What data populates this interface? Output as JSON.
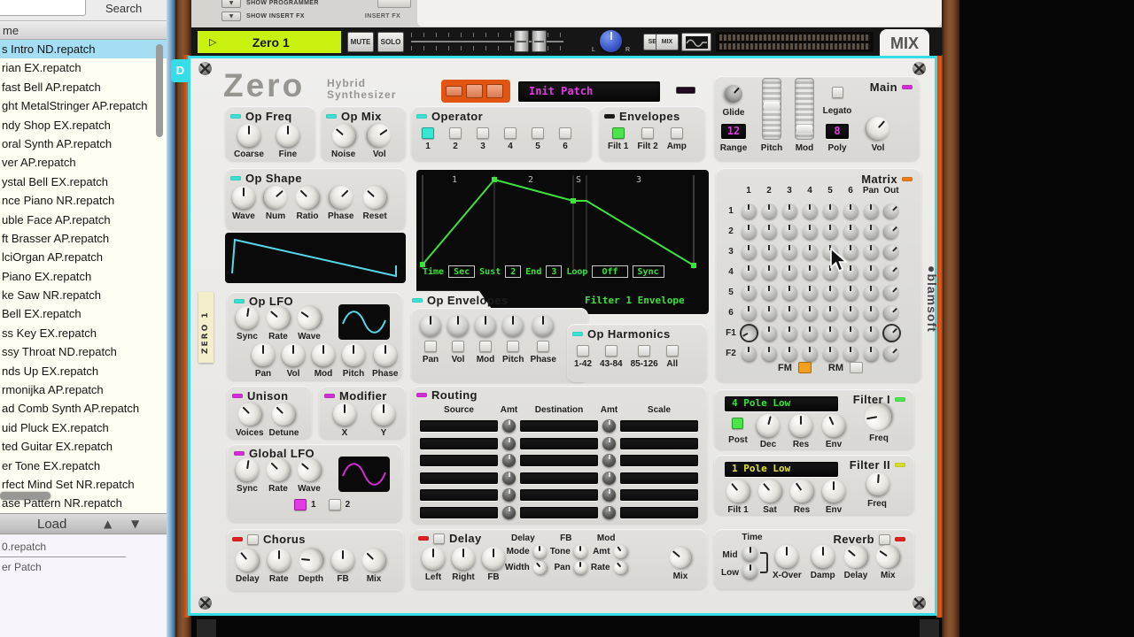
{
  "colors": {
    "selection_border": "#35dde8",
    "channel_lime": "#c9f211",
    "cyan_led": "#3ae0d4",
    "magenta_led": "#d22fd2",
    "orange_led": "#e87c1a",
    "green_led": "#4ce44c",
    "yellow_led": "#d8dc28",
    "red_led": "#e02020",
    "display_green": "#3de23d",
    "display_magenta": "#e23ae2",
    "display_yellow": "#e2e23d"
  },
  "sidebar": {
    "search_button": "Search",
    "column_header": "me",
    "files": [
      {
        "label": "s Intro ND.repatch",
        "on": true
      },
      {
        "label": "rian EX.repatch"
      },
      {
        "label": "fast Bell AP.repatch"
      },
      {
        "label": "ght MetalStringer AP.repatch"
      },
      {
        "label": "ndy Shop EX.repatch"
      },
      {
        "label": "oral Synth AP.repatch"
      },
      {
        "label": "ver AP.repatch"
      },
      {
        "label": "ystal Bell EX.repatch"
      },
      {
        "label": "nce Piano NR.repatch"
      },
      {
        "label": "uble Face AP.repatch"
      },
      {
        "label": "ft Brasser AP.repatch"
      },
      {
        "label": "lciOrgan AP.repatch"
      },
      {
        "label": "Piano EX.repatch"
      },
      {
        "label": "ke Saw NR.repatch"
      },
      {
        "label": "Bell EX.repatch"
      },
      {
        "label": "ss Key EX.repatch"
      },
      {
        "label": "ssy Throat ND.repatch"
      },
      {
        "label": "nds Up EX.repatch"
      },
      {
        "label": "rmonijka AP.repatch"
      },
      {
        "label": "ad Comb Synth AP.repatch"
      },
      {
        "label": "uid Pluck EX.repatch"
      },
      {
        "label": "ted Guitar EX.repatch"
      },
      {
        "label": "er Tone EX.repatch"
      },
      {
        "label": "rfect Mind Set NR.repatch"
      },
      {
        "label": "ase Pattern NR.repatch"
      }
    ],
    "load_button": "Load",
    "up_arrow": "▲",
    "down_arrow": "▼",
    "info_line1": "0.repatch",
    "info_line2": "er Patch"
  },
  "mixer": {
    "show_programmer": "SHOW PROGRAMMER",
    "show_insert_fx": "SHOW INSERT FX",
    "insert_fx_label": "INSERT FX",
    "channel_name": "Zero 1",
    "play_arrow": "▷",
    "mute": "MUTE",
    "solo": "SOLO",
    "pan_l": "L",
    "pan_r": "R",
    "seq": "SEQ",
    "mix": "MIX",
    "mix_tab": "MIX"
  },
  "device": {
    "fold_tab": "D",
    "tape_label": "ZERO 1",
    "brand": "Zero",
    "brand_line1": "Hybrid",
    "brand_line2": "Synthesizer",
    "patch_name": "Init Patch",
    "logo_vertical": "●blamsoft",
    "main": {
      "title": "Main",
      "glide": "Glide",
      "range": "Range",
      "range_value": "12",
      "pitch": "Pitch",
      "mod": "Mod",
      "legato": "Legato",
      "poly": "Poly",
      "poly_value": "8",
      "vol": "Vol"
    },
    "op_freq": {
      "title": "Op Freq",
      "knobs": [
        "Coarse",
        "Fine"
      ]
    },
    "op_mix": {
      "title": "Op Mix",
      "knobs": [
        "Noise",
        "Vol"
      ]
    },
    "operator": {
      "title": "Operator",
      "buttons": [
        {
          "label": "1",
          "on": true
        },
        {
          "label": "2"
        },
        {
          "label": "3"
        },
        {
          "label": "4"
        },
        {
          "label": "5"
        },
        {
          "label": "6"
        }
      ]
    },
    "envelopes": {
      "title": "Envelopes",
      "buttons": [
        {
          "label": "Filt 1",
          "on": true
        },
        {
          "label": "Filt 2"
        },
        {
          "label": "Amp"
        }
      ]
    },
    "op_shape": {
      "title": "Op Shape",
      "knobs": [
        "Wave",
        "Num",
        "Ratio",
        "Phase",
        "Reset"
      ]
    },
    "env_display": {
      "segments": [
        "1",
        "2",
        "S",
        "3"
      ],
      "time_label": "Time",
      "time_value": "Sec",
      "sust_label": "Sust",
      "sust_value": "2",
      "end_label": "End",
      "end_value": "3",
      "loop_label": "Loop",
      "loop_value": "Off",
      "sync_label": "Sync",
      "env_name": "Filter 1 Envelope"
    },
    "op_envelopes": {
      "title": "Op Envelopes",
      "knobs": [
        "Pan",
        "Vol",
        "Mod",
        "Pitch",
        "Phase"
      ]
    },
    "op_harmonics": {
      "title": "Op Harmonics",
      "buttons": [
        {
          "label": "1-42"
        },
        {
          "label": "43-84"
        },
        {
          "label": "85-126"
        },
        {
          "label": "All"
        }
      ]
    },
    "op_lfo": {
      "title": "Op LFO",
      "knobs_top": [
        "Sync",
        "Rate",
        "Wave"
      ],
      "knobs_bottom": [
        "Pan",
        "Vol",
        "Mod",
        "Pitch",
        "Phase"
      ]
    },
    "matrix": {
      "title": "Matrix",
      "cols": [
        "1",
        "2",
        "3",
        "4",
        "5",
        "6",
        "Pan",
        "Out"
      ],
      "rows": [
        "1",
        "2",
        "3",
        "4",
        "5",
        "6",
        "F1",
        "F2"
      ],
      "fm_label": "FM",
      "rm_label": "RM"
    },
    "unison": {
      "title": "Unison",
      "knobs": [
        "Voices",
        "Detune"
      ]
    },
    "modifier": {
      "title": "Modifier",
      "knobs": [
        "X",
        "Y"
      ]
    },
    "global_lfo": {
      "title": "Global LFO",
      "knobs": [
        "Sync",
        "Rate",
        "Wave"
      ],
      "buttons": [
        {
          "label": "1",
          "on": true
        },
        {
          "label": "2"
        }
      ]
    },
    "routing": {
      "title": "Routing",
      "headers": [
        "Source",
        "Amt",
        "Destination",
        "Amt",
        "Scale"
      ],
      "row_count": 6
    },
    "filter1": {
      "title": "Filter I",
      "display": "4 Pole Low",
      "post_label": "Post",
      "knobs": [
        "Dec",
        "Res",
        "Env"
      ],
      "freq_label": "Freq"
    },
    "filter2": {
      "title": "Filter II",
      "display": "1 Pole Low",
      "knobs": [
        "Filt 1",
        "Sat",
        "Res",
        "Env"
      ],
      "freq_label": "Freq"
    },
    "chorus": {
      "title": "Chorus",
      "knobs": [
        "Delay",
        "Rate",
        "Depth",
        "FB",
        "Mix"
      ]
    },
    "delay": {
      "title": "Delay",
      "big_knobs": [
        "Left",
        "Right",
        "FB"
      ],
      "col_headers": [
        "Delay",
        "FB",
        "Mod"
      ],
      "row1": [
        "Mode",
        "Tone",
        "Amt"
      ],
      "row2": [
        "Width",
        "Pan",
        "Rate"
      ],
      "mix_label": "Mix"
    },
    "reverb": {
      "title": "Reverb",
      "time_label": "Time",
      "mid_label": "Mid",
      "low_label": "Low",
      "knobs": [
        "X-Over",
        "Damp",
        "Delay",
        "Mix"
      ]
    }
  }
}
